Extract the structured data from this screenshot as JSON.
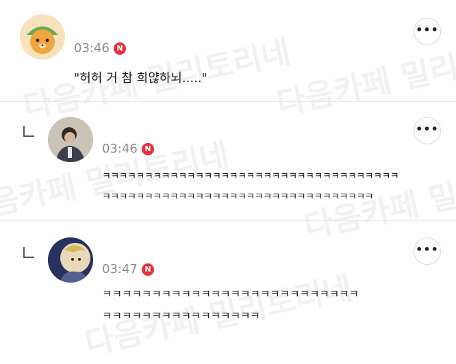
{
  "watermark_text": "다음카페 밀리토리네",
  "comments": [
    {
      "avatar": "avatar-bear-character",
      "is_reply": false,
      "time": "03:46",
      "badge": "N",
      "more_label": "•••",
      "lines": [
        "\"허허 거 참 희얂하뇌.....\""
      ]
    },
    {
      "avatar": "avatar-person-photo",
      "is_reply": true,
      "time": "03:46",
      "badge": "N",
      "more_label": "•••",
      "lines": [
        "ㅋㅋㅋㅋㅋㅋㅋㅋㅋㅋㅋㅋㅋㅋㅋㅋㅋㅋㅋㅋㅋㅋㅋㅋㅋㅋㅋㅋㅋㅋㅋㅋㅋㅋㅋ",
        "ㅋㅋㅋㅋㅋㅋㅋㅋㅋㅋㅋㅋㅋㅋㅋㅋㅋㅋㅋㅋㅋㅋㅋㅋㅋㅋㅋㅋㅋㅋㅋㅋ"
      ]
    },
    {
      "avatar": "avatar-illustration",
      "is_reply": true,
      "time": "03:47",
      "badge": "N",
      "more_label": "•••",
      "lines": [
        "ㅋㅋㅋㅋㅋㅋㅋㅋㅋㅋㅋㅋㅋㅋㅋㅋㅋㅋㅋㅋㅋㅋㅋㅋㅋㅋ",
        "ㅋㅋㅋㅋㅋㅋㅋㅋㅋㅋㅋㅋㅋㅋㅋㅋ"
      ]
    }
  ]
}
